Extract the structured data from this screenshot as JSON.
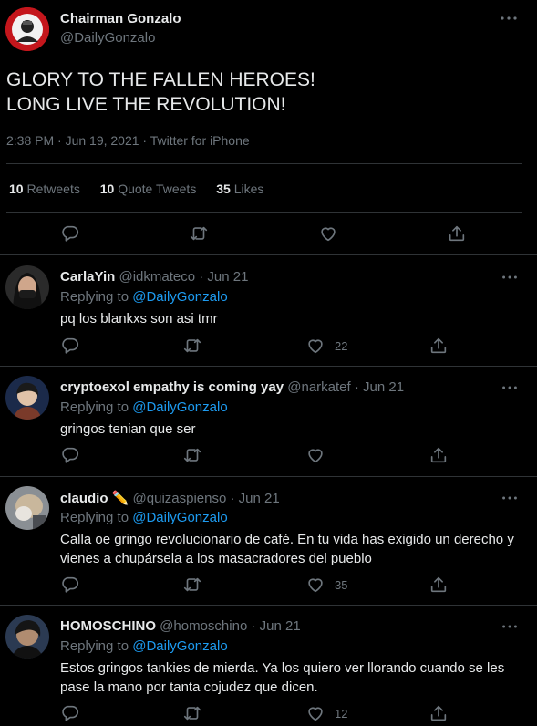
{
  "main": {
    "name": "Chairman Gonzalo",
    "handle": "@DailyGonzalo",
    "text": "GLORY TO THE FALLEN HEROES!\nLONG LIVE THE REVOLUTION!",
    "meta": "2:38 PM · Jun 19, 2021 · Twitter for iPhone",
    "retweets_count": "10",
    "retweets_label": "Retweets",
    "quotes_count": "10",
    "quotes_label": "Quote Tweets",
    "likes_count": "35",
    "likes_label": "Likes"
  },
  "replying_to_label": "Replying to",
  "replies": [
    {
      "name": "CarlaYin",
      "handle": "@idkmateco",
      "sep": "·",
      "date": "Jun 21",
      "replying_to": "@DailyGonzalo",
      "text": "pq los blankxs son asi tmr",
      "likes": "22"
    },
    {
      "name": "cryptoexol empathy is coming yay",
      "handle": "@narkatef",
      "sep": "·",
      "date": "Jun 21",
      "replying_to": "@DailyGonzalo",
      "text": "gringos tenian que ser",
      "likes": ""
    },
    {
      "name": "claudio ✏️",
      "handle": "@quizaspienso",
      "sep": "·",
      "date": "Jun 21",
      "replying_to": "@DailyGonzalo",
      "text": "Calla oe gringo revolucionario de café. En tu vida has exigido un derecho y vienes a chupársela a los masacradores del pueblo",
      "likes": "35"
    },
    {
      "name": "HOMOSCHINO",
      "handle": "@homoschino",
      "sep": "·",
      "date": "Jun 21",
      "replying_to": "@DailyGonzalo",
      "text": "Estos gringos tankies de mierda. Ya los quiero ver llorando cuando se les pase la mano por tanta cojudez que dicen.",
      "likes": "12"
    }
  ],
  "colors": {
    "background": "#000000",
    "text": "#e7e9ea",
    "muted": "#6e767d",
    "link": "#1d9bf0",
    "divider": "#2f3336"
  }
}
